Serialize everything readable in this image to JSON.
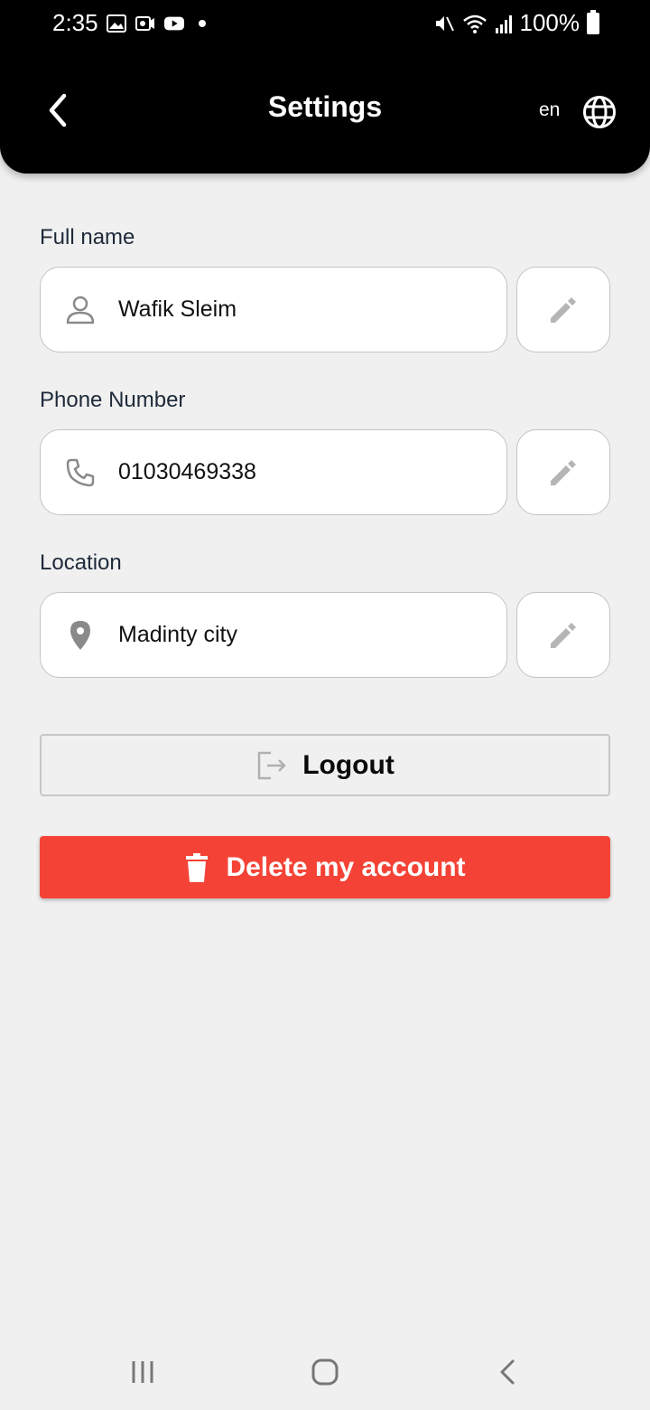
{
  "status_bar": {
    "time": "2:35",
    "battery": "100%"
  },
  "header": {
    "title": "Settings",
    "language": "en"
  },
  "fields": {
    "full_name": {
      "label": "Full name",
      "value": "Wafik Sleim",
      "icon": "person-icon"
    },
    "phone": {
      "label": "Phone Number",
      "value": "01030469338",
      "icon": "phone-icon"
    },
    "location": {
      "label": "Location",
      "value": "Madinty city",
      "icon": "location-pin-icon"
    }
  },
  "actions": {
    "logout_label": "Logout",
    "delete_label": "Delete my account"
  },
  "colors": {
    "header_bg": "#000000",
    "page_bg": "#f0f0f0",
    "danger": "#f44336",
    "icon_gray": "#8a8a8a"
  }
}
